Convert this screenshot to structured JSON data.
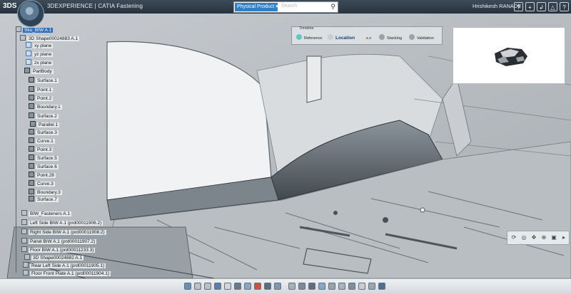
{
  "header": {
    "logo_text": "3DS",
    "app_title": "3DEXPERIENCE | CATIA Fastening",
    "search": {
      "scope": "Physical Product ▾",
      "placeholder": "Search"
    },
    "user_name": "Hrishikesh RANADE",
    "icons": [
      "question-icon",
      "add-icon",
      "share-icon",
      "settings-icon",
      "help-icon"
    ],
    "icon_glyphs": [
      "?",
      "+",
      "↲",
      "△",
      "?"
    ]
  },
  "tree": {
    "nodes": [
      {
        "label": "Sku_BIW A.1",
        "selected": true
      },
      {
        "label": "3D Shape00024883 A.1"
      },
      {
        "label": "xy plane"
      },
      {
        "label": "yz plane"
      },
      {
        "label": "zx plane"
      },
      {
        "label": "PartBody"
      },
      {
        "label": "Surface.1"
      },
      {
        "label": "Point.1"
      },
      {
        "label": "Point.2"
      },
      {
        "label": "Boundary.1"
      },
      {
        "label": "Surface.2"
      },
      {
        "label": "Parallel.1"
      },
      {
        "label": "Surface.3"
      },
      {
        "label": "Curve.1"
      },
      {
        "label": "Point.3"
      },
      {
        "label": "Surface.5"
      },
      {
        "label": "Surface.6"
      },
      {
        "label": "Point.28"
      },
      {
        "label": "Curve.3"
      },
      {
        "label": "Boundary.3"
      },
      {
        "label": "Surface.7"
      },
      {
        "label": "BIW_Fasteners A.1"
      },
      {
        "label": "Left Side BIW A.1 (prd00011906.2)"
      },
      {
        "label": "Right Side BIW A.1 (prd00011908.2)"
      },
      {
        "label": "Panel BIW A.1 (prd00011907.2)"
      },
      {
        "label": "Floor BIW A.1 (prd00011233.3)"
      },
      {
        "label": "3D Shape00024882 A.1"
      },
      {
        "label": "Rear Left Side A.1 (prd00011905.1)"
      },
      {
        "label": "Floor Front Plate A.1 (prd00011904.1)"
      }
    ]
  },
  "timeline": {
    "title": "Timeline",
    "steps": [
      "Reference",
      "Location",
      "x.x",
      "Stacking",
      "Validation"
    ],
    "active": "Location"
  },
  "colors": {
    "topbar": "#27323d",
    "selection": "#2f6fb8",
    "timeline_active": "#62c6c7",
    "viewport_bg": "#d6d9dc"
  }
}
